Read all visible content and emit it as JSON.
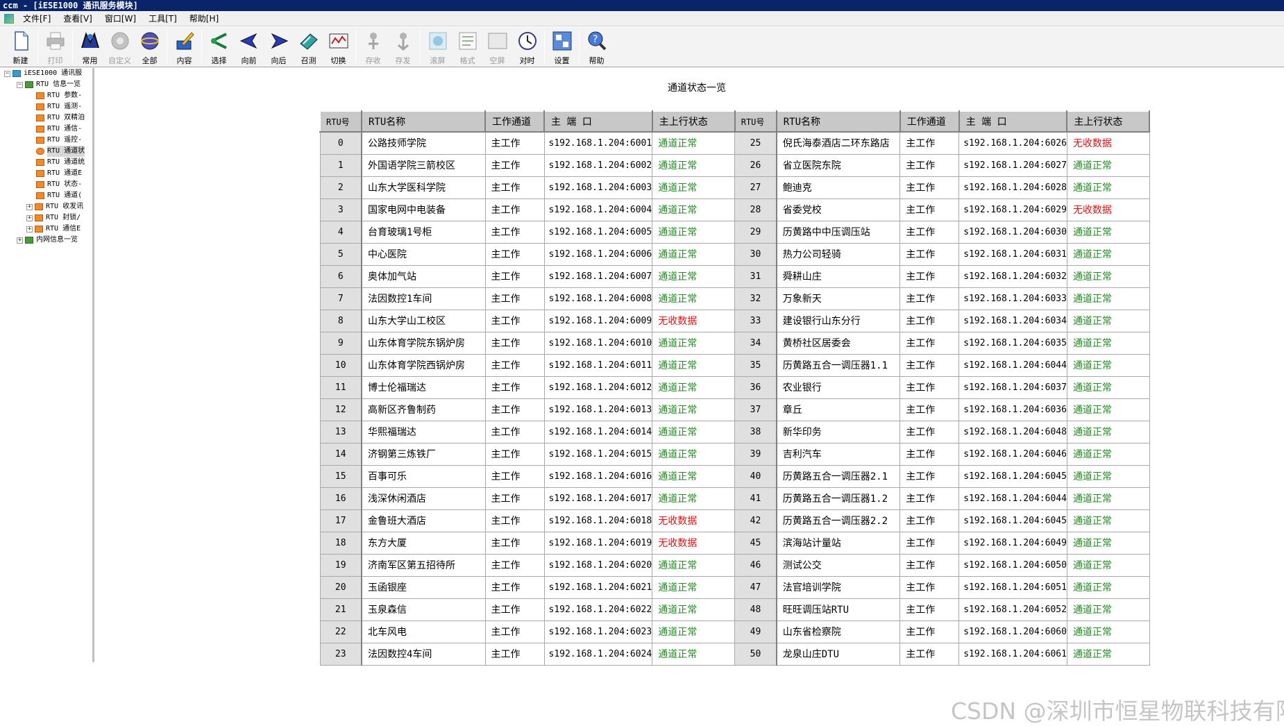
{
  "window": {
    "title": "ccm - [iESE1000 通讯服务模块]"
  },
  "menu": [
    "文件[F]",
    "查看[V]",
    "窗口[W]",
    "工具[T]",
    "帮助[H]"
  ],
  "toolbar": {
    "buttons": [
      {
        "label": "新建",
        "icon": "new-file-icon",
        "enabled": true
      },
      {
        "label": "打印",
        "icon": "printer-icon",
        "enabled": false
      },
      {
        "label": "常用",
        "icon": "common-icon",
        "enabled": true
      },
      {
        "label": "自定义",
        "icon": "custom-icon",
        "enabled": false
      },
      {
        "label": "全部",
        "icon": "all-icon",
        "enabled": true
      },
      {
        "label": "内容",
        "icon": "content-icon",
        "enabled": true
      },
      {
        "label": "选择",
        "icon": "select-icon",
        "enabled": true
      },
      {
        "label": "向前",
        "icon": "back-arrow-icon",
        "enabled": true
      },
      {
        "label": "向后",
        "icon": "forward-arrow-icon",
        "enabled": true
      },
      {
        "label": "召测",
        "icon": "call-test-icon",
        "enabled": true
      },
      {
        "label": "切换",
        "icon": "switch-icon",
        "enabled": true
      },
      {
        "label": "存收",
        "icon": "save-receive-icon",
        "enabled": false
      },
      {
        "label": "存发",
        "icon": "save-send-icon",
        "enabled": false
      },
      {
        "label": "滚屏",
        "icon": "scroll-screen-icon",
        "enabled": false
      },
      {
        "label": "格式",
        "icon": "format-icon",
        "enabled": false
      },
      {
        "label": "空屏",
        "icon": "blank-screen-icon",
        "enabled": false
      },
      {
        "label": "对时",
        "icon": "clock-sync-icon",
        "enabled": true
      },
      {
        "label": "设置",
        "icon": "settings-icon",
        "enabled": true
      },
      {
        "label": "帮助",
        "icon": "help-icon",
        "enabled": true
      }
    ]
  },
  "tree": {
    "root": "iESE1000 通讯服",
    "group1": "RTU 信息一览",
    "children": [
      {
        "label": "RTU 参数-",
        "icon": "folder-item-icon",
        "selected": false,
        "expandable": false
      },
      {
        "label": "RTU 遥测-",
        "icon": "folder-item-icon",
        "selected": false,
        "expandable": false
      },
      {
        "label": "RTU 双精泊",
        "icon": "folder-item-icon",
        "selected": false,
        "expandable": false
      },
      {
        "label": "RTU 通信-",
        "icon": "folder-item-icon",
        "selected": false,
        "expandable": false
      },
      {
        "label": "RTU 遥控-",
        "icon": "folder-item-icon",
        "selected": false,
        "expandable": false
      },
      {
        "label": "RTU 通道状",
        "icon": "status-item-icon",
        "selected": true,
        "expandable": false
      },
      {
        "label": "RTU 通道统",
        "icon": "folder-item-icon",
        "selected": false,
        "expandable": false
      },
      {
        "label": "RTU 通道E",
        "icon": "folder-item-icon",
        "selected": false,
        "expandable": false
      },
      {
        "label": "RTU 状态-",
        "icon": "folder-item-icon",
        "selected": false,
        "expandable": false
      },
      {
        "label": "RTU 通道(",
        "icon": "folder-item-icon",
        "selected": false,
        "expandable": false
      },
      {
        "label": "RTU 收发讯",
        "icon": "folder-item-icon",
        "selected": false,
        "expandable": true
      },
      {
        "label": "RTU 封锁/",
        "icon": "folder-item-icon",
        "selected": false,
        "expandable": true
      },
      {
        "label": "RTU 通信E",
        "icon": "folder-item-icon",
        "selected": false,
        "expandable": true
      }
    ],
    "group2": "内网信息一览"
  },
  "page": {
    "title": "通道状态一览"
  },
  "table": {
    "headers": [
      "RTU号",
      "RTU名称",
      "工作通道",
      "主 端 口",
      "主上行状态",
      "RTU号",
      "RTU名称",
      "工作通道",
      "主 端 口",
      "主上行状态"
    ],
    "status_colors": {
      "ok": "#1e8c1e",
      "bad": "#e01010"
    },
    "rows": [
      {
        "l": [
          "0",
          "公路技师学院",
          "主工作",
          "s192.168.1.204:6001",
          "通道正常"
        ],
        "r": [
          "25",
          "倪氏海泰酒店二环东路店",
          "主工作",
          "s192.168.1.204:6026",
          "无收数据"
        ]
      },
      {
        "l": [
          "1",
          "外国语学院三箭校区",
          "主工作",
          "s192.168.1.204:6002",
          "通道正常"
        ],
        "r": [
          "26",
          "省立医院东院",
          "主工作",
          "s192.168.1.204:6027",
          "通道正常"
        ]
      },
      {
        "l": [
          "2",
          "山东大学医科学院",
          "主工作",
          "s192.168.1.204:6003",
          "通道正常"
        ],
        "r": [
          "27",
          "鲍迪克",
          "主工作",
          "s192.168.1.204:6028",
          "通道正常"
        ]
      },
      {
        "l": [
          "3",
          "国家电网中电装备",
          "主工作",
          "s192.168.1.204:6004",
          "通道正常"
        ],
        "r": [
          "28",
          "省委党校",
          "主工作",
          "s192.168.1.204:6029",
          "无收数据"
        ]
      },
      {
        "l": [
          "4",
          "台育玻璃1号柜",
          "主工作",
          "s192.168.1.204:6005",
          "通道正常"
        ],
        "r": [
          "29",
          "历黄路中中压调压站",
          "主工作",
          "s192.168.1.204:6030",
          "通道正常"
        ]
      },
      {
        "l": [
          "5",
          "中心医院",
          "主工作",
          "s192.168.1.204:6006",
          "通道正常"
        ],
        "r": [
          "30",
          "热力公司轻骑",
          "主工作",
          "s192.168.1.204:6031",
          "通道正常"
        ]
      },
      {
        "l": [
          "6",
          "奥体加气站",
          "主工作",
          "s192.168.1.204:6007",
          "通道正常"
        ],
        "r": [
          "31",
          "舜耕山庄",
          "主工作",
          "s192.168.1.204:6032",
          "通道正常"
        ]
      },
      {
        "l": [
          "7",
          "法因数控1车间",
          "主工作",
          "s192.168.1.204:6008",
          "通道正常"
        ],
        "r": [
          "32",
          "万象新天",
          "主工作",
          "s192.168.1.204:6033",
          "通道正常"
        ]
      },
      {
        "l": [
          "8",
          "山东大学山工校区",
          "主工作",
          "s192.168.1.204:6009",
          "无收数据"
        ],
        "r": [
          "33",
          "建设银行山东分行",
          "主工作",
          "s192.168.1.204:6034",
          "通道正常"
        ]
      },
      {
        "l": [
          "9",
          "山东体育学院东锅炉房",
          "主工作",
          "s192.168.1.204:6010",
          "通道正常"
        ],
        "r": [
          "34",
          "黄桥社区居委会",
          "主工作",
          "s192.168.1.204:6035",
          "通道正常"
        ]
      },
      {
        "l": [
          "10",
          "山东体育学院西锅炉房",
          "主工作",
          "s192.168.1.204:6011",
          "通道正常"
        ],
        "r": [
          "35",
          "历黄路五合一调压器1.1",
          "主工作",
          "s192.168.1.204:6044",
          "通道正常"
        ]
      },
      {
        "l": [
          "11",
          "博士伦福瑞达",
          "主工作",
          "s192.168.1.204:6012",
          "通道正常"
        ],
        "r": [
          "36",
          "农业银行",
          "主工作",
          "s192.168.1.204:6037",
          "通道正常"
        ]
      },
      {
        "l": [
          "12",
          "高新区齐鲁制药",
          "主工作",
          "s192.168.1.204:6013",
          "通道正常"
        ],
        "r": [
          "37",
          "章丘",
          "主工作",
          "s192.168.1.204:6036",
          "通道正常"
        ]
      },
      {
        "l": [
          "13",
          "华熙福瑞达",
          "主工作",
          "s192.168.1.204:6014",
          "通道正常"
        ],
        "r": [
          "38",
          "新华印务",
          "主工作",
          "s192.168.1.204:6048",
          "通道正常"
        ]
      },
      {
        "l": [
          "14",
          "济钢第三炼铁厂",
          "主工作",
          "s192.168.1.204:6015",
          "通道正常"
        ],
        "r": [
          "39",
          "吉利汽车",
          "主工作",
          "s192.168.1.204:6046",
          "通道正常"
        ]
      },
      {
        "l": [
          "15",
          "百事可乐",
          "主工作",
          "s192.168.1.204:6016",
          "通道正常"
        ],
        "r": [
          "40",
          "历黄路五合一调压器2.1",
          "主工作",
          "s192.168.1.204:6045",
          "通道正常"
        ]
      },
      {
        "l": [
          "16",
          "浅深休闲酒店",
          "主工作",
          "s192.168.1.204:6017",
          "通道正常"
        ],
        "r": [
          "41",
          "历黄路五合一调压器1.2",
          "主工作",
          "s192.168.1.204:6044",
          "通道正常"
        ]
      },
      {
        "l": [
          "17",
          "金鲁班大酒店",
          "主工作",
          "s192.168.1.204:6018",
          "无收数据"
        ],
        "r": [
          "42",
          "历黄路五合一调压器2.2",
          "主工作",
          "s192.168.1.204:6045",
          "通道正常"
        ]
      },
      {
        "l": [
          "18",
          "东方大厦",
          "主工作",
          "s192.168.1.204:6019",
          "无收数据"
        ],
        "r": [
          "45",
          "滨海站计量站",
          "主工作",
          "s192.168.1.204:6049",
          "通道正常"
        ]
      },
      {
        "l": [
          "19",
          "济南军区第五招待所",
          "主工作",
          "s192.168.1.204:6020",
          "通道正常"
        ],
        "r": [
          "46",
          "测试公交",
          "主工作",
          "s192.168.1.204:6050",
          "通道正常"
        ]
      },
      {
        "l": [
          "20",
          "玉函银座",
          "主工作",
          "s192.168.1.204:6021",
          "通道正常"
        ],
        "r": [
          "47",
          "法官培训学院",
          "主工作",
          "s192.168.1.204:6051",
          "通道正常"
        ]
      },
      {
        "l": [
          "21",
          "玉泉森信",
          "主工作",
          "s192.168.1.204:6022",
          "通道正常"
        ],
        "r": [
          "48",
          "旺旺调压站RTU",
          "主工作",
          "s192.168.1.204:6052",
          "通道正常"
        ]
      },
      {
        "l": [
          "22",
          "北车风电",
          "主工作",
          "s192.168.1.204:6023",
          "通道正常"
        ],
        "r": [
          "49",
          "山东省检察院",
          "主工作",
          "s192.168.1.204:6060",
          "通道正常"
        ]
      },
      {
        "l": [
          "23",
          "法因数控4车间",
          "主工作",
          "s192.168.1.204:6024",
          "通道正常"
        ],
        "r": [
          "50",
          "龙泉山庄DTU",
          "主工作",
          "s192.168.1.204:6061",
          "通道正常"
        ]
      }
    ]
  },
  "watermark": "CSDN @深圳市恒星物联科技有限公司"
}
